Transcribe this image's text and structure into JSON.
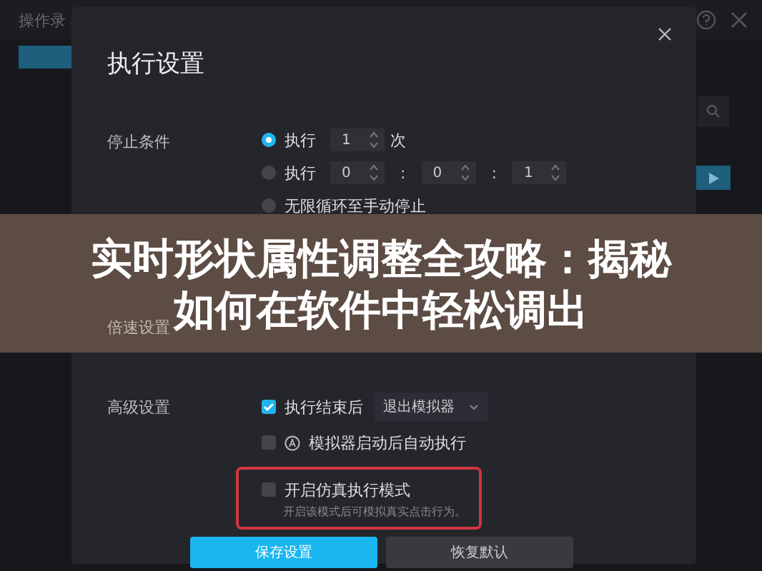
{
  "background_app": {
    "title": "操作录"
  },
  "dialog": {
    "title": "执行设置",
    "stop_condition": {
      "label": "停止条件",
      "options": [
        {
          "kind": "count",
          "selected": true,
          "label": "执行",
          "value": "1",
          "unit": "次"
        },
        {
          "kind": "time",
          "selected": false,
          "label": "执行",
          "fields": [
            {
              "value": "0"
            },
            {
              "sep": ":",
              "value": "0"
            },
            {
              "sep": ":",
              "value": "1"
            }
          ]
        },
        {
          "kind": "plain",
          "selected": false,
          "label": "无限循环至手动停止"
        }
      ]
    },
    "speed": {
      "label": "倍速设置"
    },
    "advanced": {
      "label": "高级设置",
      "options": [
        {
          "kind": "dropdown",
          "checked": true,
          "label": "执行结束后",
          "dropdown": "退出模拟器"
        },
        {
          "kind": "icon",
          "checked": false,
          "label": "模拟器启动后自动执行"
        },
        {
          "kind": "highlighted",
          "checked": false,
          "label": "开启仿真执行模式",
          "note": "开启该模式后可模拟真实点击行为。"
        }
      ]
    },
    "buttons": [
      {
        "kind": "primary",
        "label": "保存设置"
      },
      {
        "kind": "secondary",
        "label": "恢复默认"
      }
    ]
  },
  "banner": {
    "lines": [
      "实时形状属性调整全攻略：揭秘",
      "如何在软件中轻松调出"
    ]
  }
}
